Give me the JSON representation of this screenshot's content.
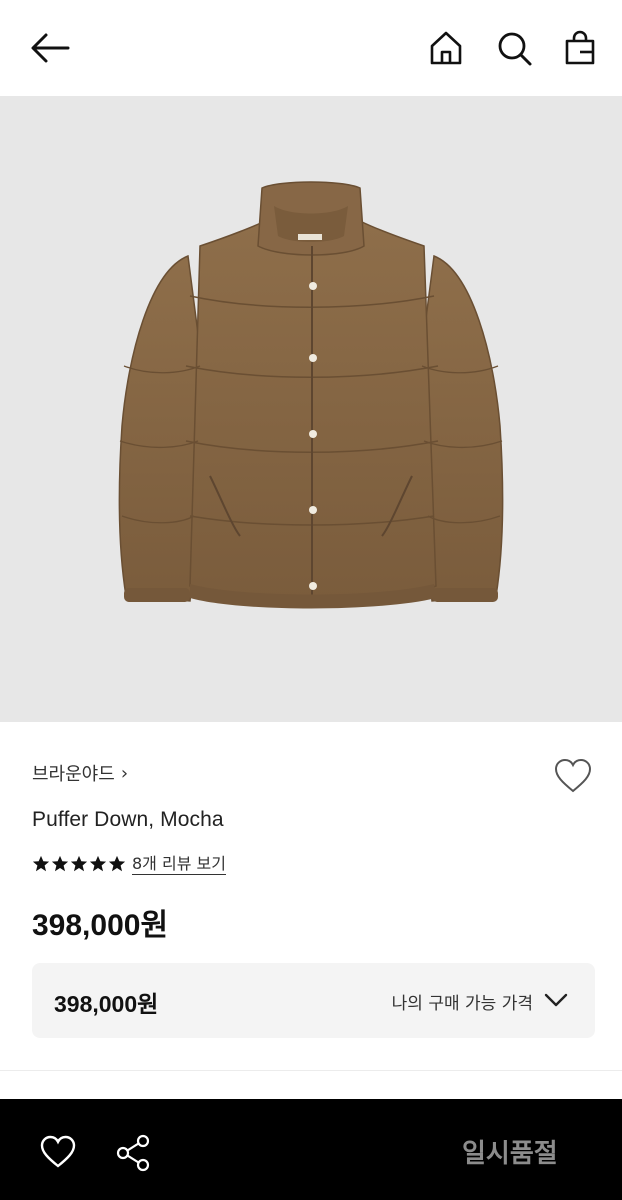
{
  "header": {
    "icons": [
      "arrow-left-icon",
      "home-icon",
      "search-icon",
      "shopping-bag-icon"
    ]
  },
  "hero": {
    "background": "#e7e7e7",
    "jacket_color": "#8a6a47"
  },
  "product": {
    "brand": "브라운야드",
    "brand_chevron": "›",
    "name": "Puffer Down, Mocha",
    "rating_stars": 5,
    "rating_max": 5,
    "review_link": "8개 리뷰 보기",
    "price": "398,000원"
  },
  "price_box": {
    "my_price": "398,000원",
    "label": "나의 구매 가능 가격"
  },
  "bottom_bar": {
    "background": "#000000",
    "status": "일시품절",
    "icons": [
      "heart-icon",
      "share-icon"
    ]
  }
}
